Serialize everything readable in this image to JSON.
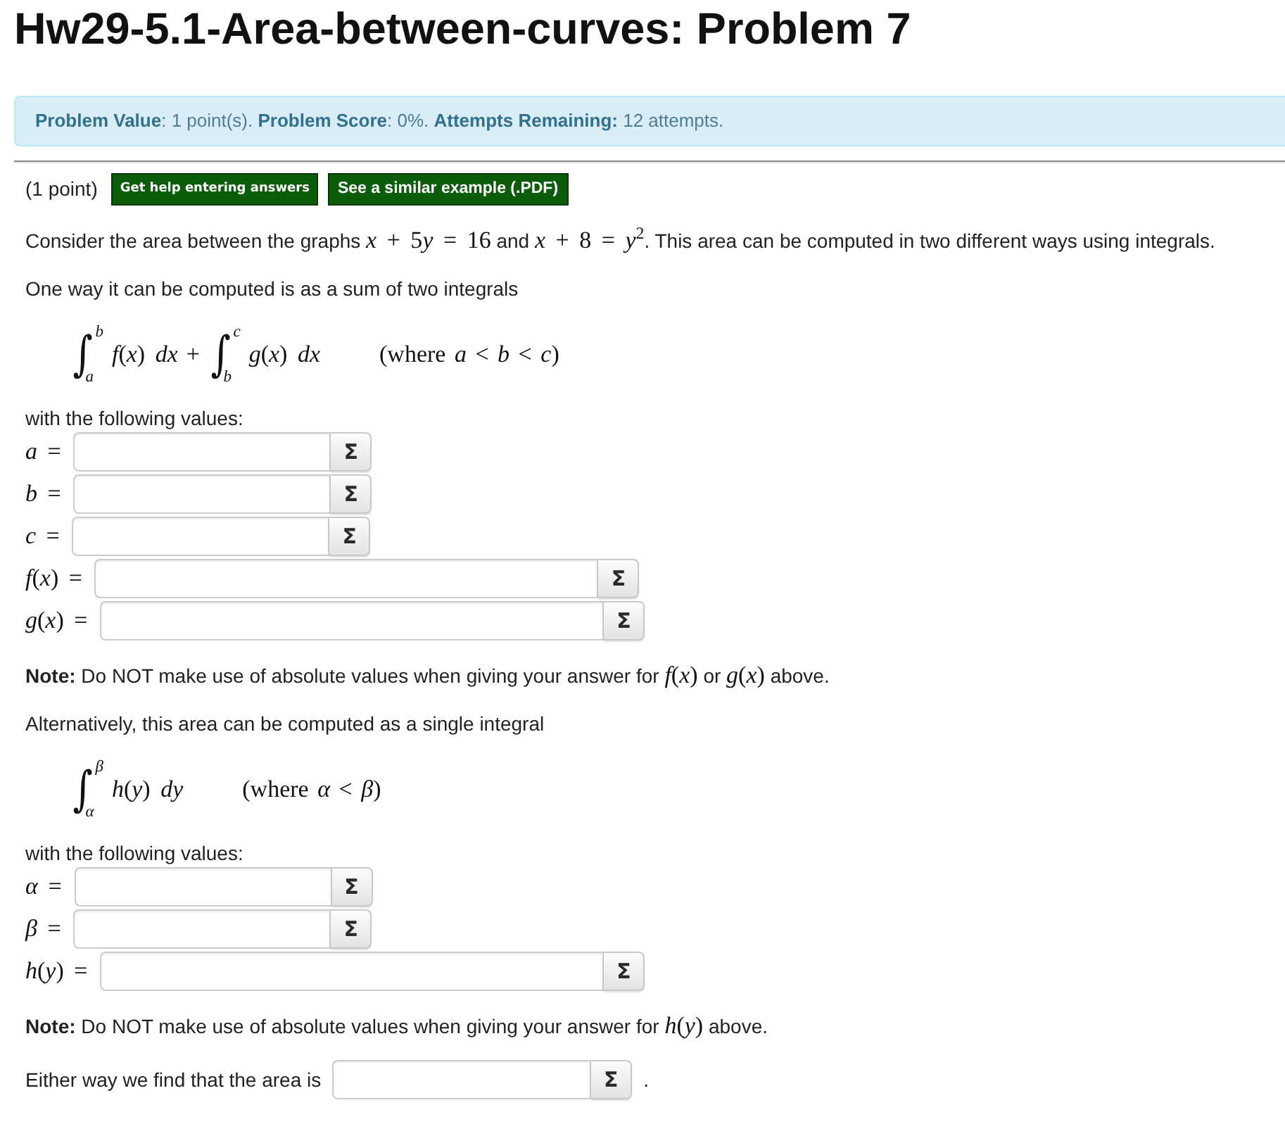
{
  "title": "Hw29-5.1-Area-between-curves: Problem 7",
  "info_bar": {
    "text": "**Problem Value**: 1 point(s). **Problem Score**: 0%. **Attempts Remaining:** 12 attempts."
  },
  "problem": {
    "point_value": "(1 point)",
    "buttons": [
      {
        "kind": "help",
        "label": "Get help entering answers"
      },
      {
        "kind": "example",
        "label": "See a similar example (.PDF)"
      }
    ],
    "content": [
      {
        "kind": "paragraph",
        "parts": [
          {
            "kind": "text",
            "text": "Consider the area between the graphs "
          },
          {
            "kind": "math",
            "text": "*x* + 5"
          },
          {
            "kind": "math",
            "text": "*y* = 16"
          },
          {
            "kind": "text",
            "text": " and "
          },
          {
            "kind": "math",
            "text": "*x* + 8 = *y*$^{2}$"
          },
          {
            "kind": "text",
            "text": ". This area can be computed in two different ways using integrals."
          }
        ]
      },
      {
        "kind": "paragraph",
        "parts": [
          {
            "kind": "text",
            "text": "One way it can be computed is as a sum of two integrals"
          }
        ]
      },
      {
        "kind": "formula",
        "terms": [
          {
            "kind": "integral",
            "sign": "∫",
            "upper": "b",
            "lower": "a",
            "integrand": "*f*(*x*) *dx*"
          },
          {
            "kind": "operator",
            "text": "+"
          },
          {
            "kind": "integral",
            "sign": "∫",
            "upper": "c",
            "lower": "b",
            "integrand": "*g*(*x*) *dx*"
          }
        ],
        "condition": "(where *a* < *b* < *c*)"
      },
      {
        "kind": "paragraph",
        "parts": [
          {
            "kind": "text",
            "text": "with the following values:"
          }
        ]
      },
      {
        "kind": "answers",
        "rows": [
          {
            "kind": "short",
            "label": "*a* =",
            "button": "Σ"
          },
          {
            "kind": "short",
            "label": "*b* =",
            "button": "Σ"
          },
          {
            "kind": "short",
            "label": "*c* =",
            "button": "Σ"
          },
          {
            "kind": "long",
            "label": "*f*(*x*) =",
            "button": "Σ"
          },
          {
            "kind": "long",
            "label": "*g*(*x*) =",
            "button": "Σ"
          }
        ]
      },
      {
        "kind": "paragraph",
        "parts": [
          {
            "kind": "text",
            "text": "**Note:** Do NOT make use of absolute values when giving your answer for "
          },
          {
            "kind": "math",
            "text": "*f*(*x*)"
          },
          {
            "kind": "text",
            "text": " or "
          },
          {
            "kind": "math",
            "text": "*g*(*x*)"
          },
          {
            "kind": "text",
            "text": " above."
          }
        ]
      },
      {
        "kind": "paragraph",
        "parts": [
          {
            "kind": "text",
            "text": "Alternatively, this area can be computed as a single integral"
          }
        ]
      },
      {
        "kind": "formula",
        "terms": [
          {
            "kind": "integral",
            "sign": "∫",
            "upper": "β",
            "lower": "α",
            "integrand": "*h*(*y*) *dy*"
          }
        ],
        "condition": "(where *α* < *β*)"
      },
      {
        "kind": "paragraph",
        "parts": [
          {
            "kind": "text",
            "text": "with the following values:"
          }
        ]
      },
      {
        "kind": "answers",
        "rows": [
          {
            "kind": "short",
            "label": "*α* =",
            "button": "Σ"
          },
          {
            "kind": "short",
            "label": "*β* =",
            "button": "Σ"
          },
          {
            "kind": "long",
            "label": "*h*(*y*) =",
            "button": "Σ"
          }
        ]
      },
      {
        "kind": "paragraph",
        "parts": [
          {
            "kind": "text",
            "text": "**Note:** Do NOT make use of absolute values when giving your answer for "
          },
          {
            "kind": "math",
            "text": "*h*(*y*)"
          },
          {
            "kind": "text",
            "text": " above."
          }
        ]
      },
      {
        "kind": "answer_line",
        "before": "Either way we find that the area is",
        "button": "Σ",
        "after": "."
      }
    ]
  }
}
